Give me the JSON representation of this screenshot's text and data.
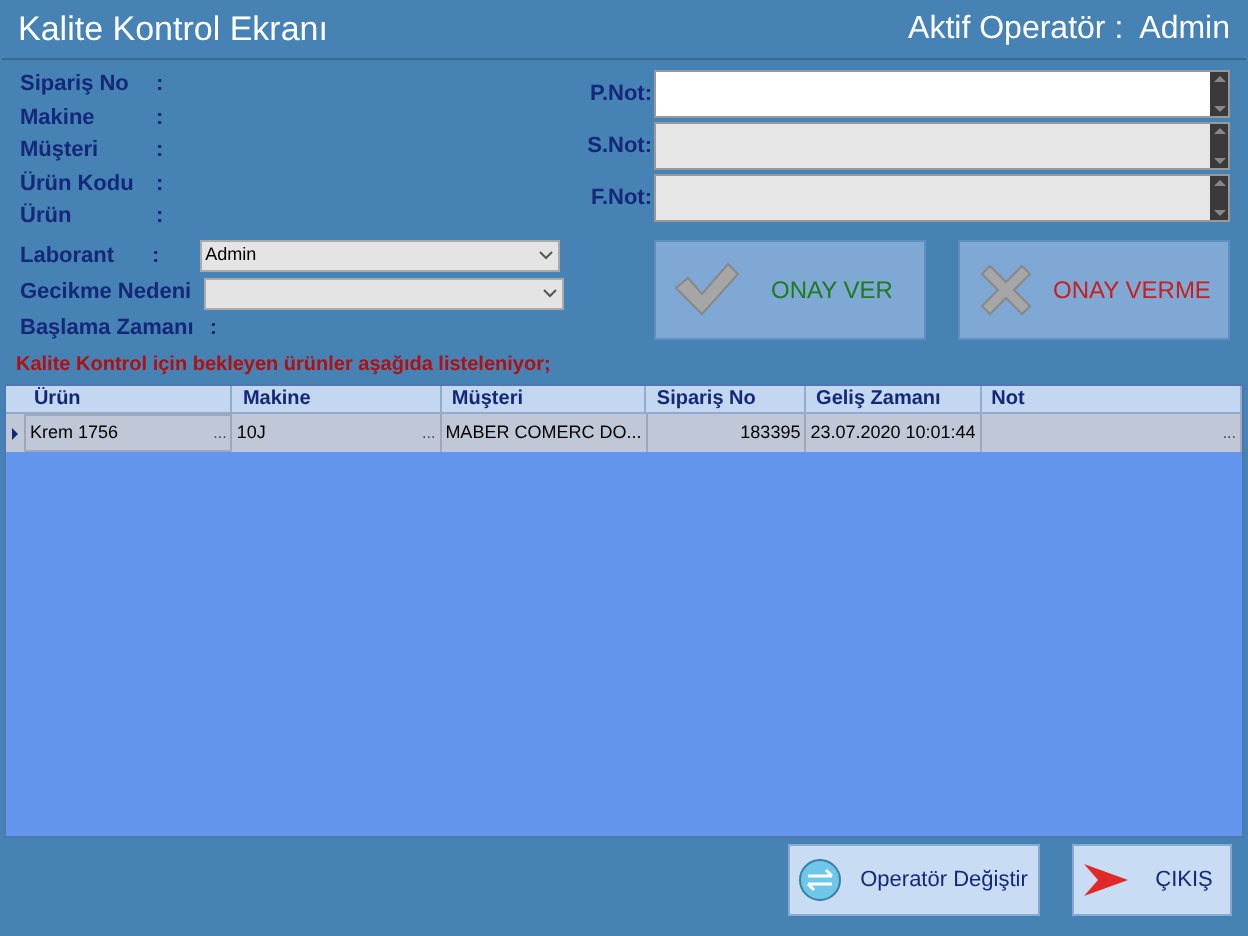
{
  "window": {
    "title": "Kalite Kontrol Ekranı",
    "operator_label": "Aktif Operatör :",
    "operator": "Admin"
  },
  "info_fields": [
    {
      "label": "Sipariş No",
      "colon": ":"
    },
    {
      "label": "Makine",
      "colon": ":"
    },
    {
      "label": "Müşteri",
      "colon": ":"
    },
    {
      "label": "Ürün Kodu",
      "colon": ":"
    },
    {
      "label": "Ürün",
      "colon": ":"
    }
  ],
  "laborant": {
    "label": "Laborant",
    "colon": ":",
    "value": "Admin"
  },
  "gecikme": {
    "label": "Gecikme Nedeni"
  },
  "baslama": {
    "label": "Başlama Zamanı",
    "colon": ":"
  },
  "notes": [
    {
      "label": "P.Not:",
      "focused": true
    },
    {
      "label": "S.Not:",
      "focused": false
    },
    {
      "label": "F.Not:",
      "focused": false
    }
  ],
  "approve_buttons": [
    {
      "kind": "approve",
      "label": "ONAY VER"
    },
    {
      "kind": "reject",
      "label": "ONAY VERME"
    }
  ],
  "info_message": "Kalite Kontrol için bekleyen ürünler aşağıda listeleniyor;",
  "table": {
    "columns": [
      "Ürün",
      "Makine",
      "Müşteri",
      "Sipariş No",
      "Geliş Zamanı",
      "Not"
    ],
    "rows": [
      {
        "selected": true,
        "cells": [
          {
            "text": "Krem 1756",
            "button": "...",
            "numeric": false
          },
          {
            "text": "10J",
            "button": "...",
            "numeric": false
          },
          {
            "text": "MABER COMERC DO..."
          },
          {
            "text": "183395",
            "numeric": true
          },
          {
            "text": "23.07.2020 10:01:44"
          },
          {
            "button": "..."
          }
        ]
      }
    ]
  },
  "footer_buttons": [
    {
      "kind": "switch",
      "label": "Operatör Değiştir"
    },
    {
      "kind": "exit",
      "label": "ÇIKIŞ"
    }
  ]
}
